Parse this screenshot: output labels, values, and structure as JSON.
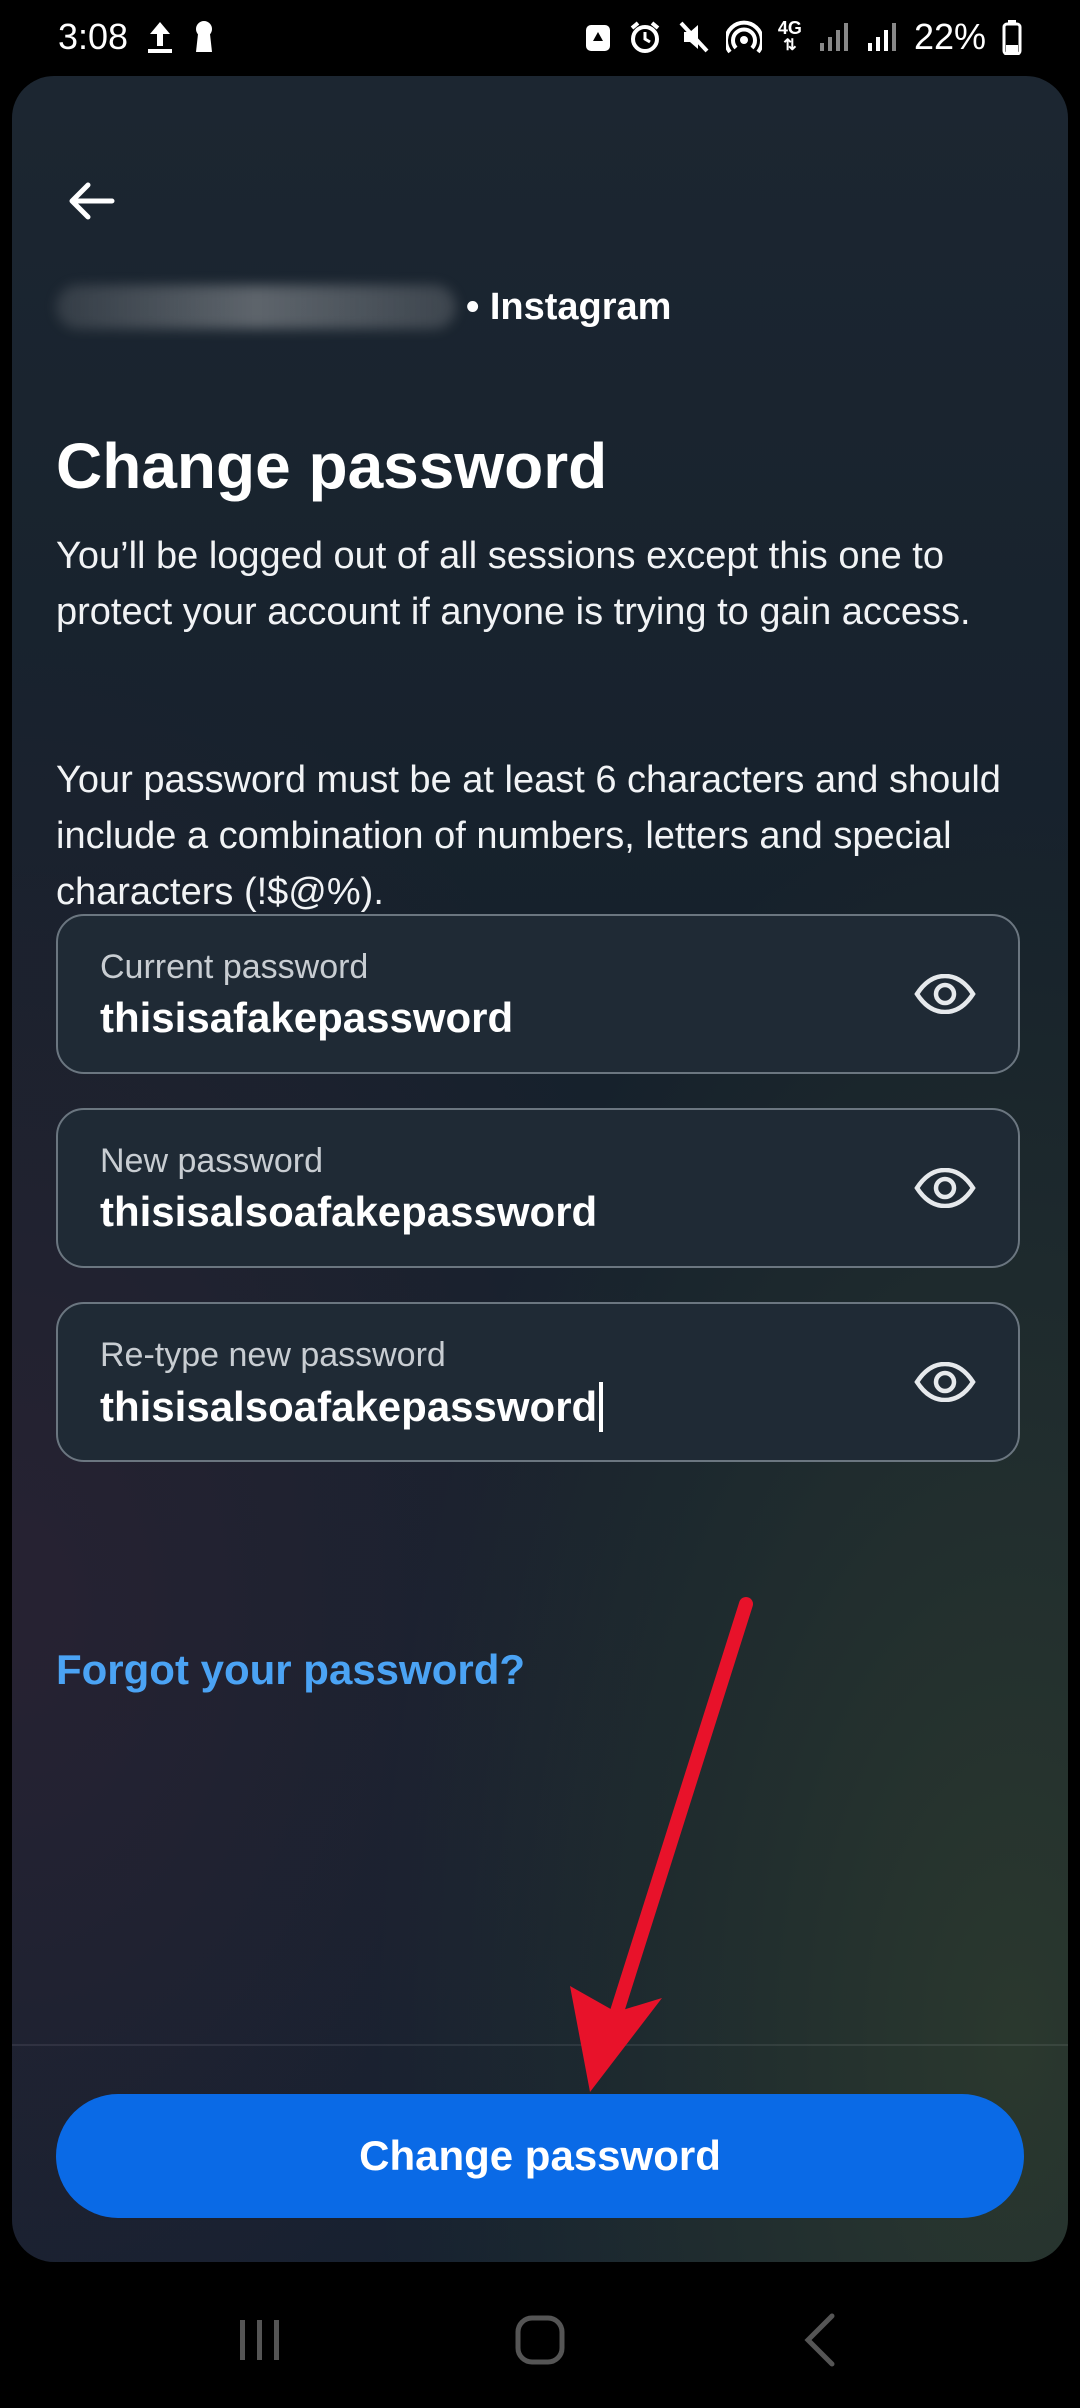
{
  "status_bar": {
    "time": "3:08",
    "network": "4G",
    "battery": "22%",
    "icons": [
      "upload-icon",
      "keyhole-icon",
      "recycle-icon",
      "alarm-icon",
      "mute-icon",
      "hotspot-icon",
      "signal-icon",
      "battery-icon"
    ]
  },
  "header": {
    "account_suffix": "• Instagram",
    "title": "Change password"
  },
  "description": {
    "p1": "You’ll be logged out of all sessions except this one to protect your account if anyone is trying to gain access.",
    "p2": "Your password must be at least 6 characters and should include a combination of numbers, letters and special characters (!$@%)."
  },
  "fields": [
    {
      "label": "Current password",
      "value": "thisisafakepassword"
    },
    {
      "label": "New password",
      "value": "thisisalsoafakepassword"
    },
    {
      "label": "Re-type new password",
      "value": "thisisalsoafakepassword"
    }
  ],
  "forgot_link": "Forgot your password?",
  "primary_button": "Change password",
  "colors": {
    "accent": "#0a6ae6",
    "link": "#4ba3f4",
    "annotation_arrow": "#e8122a"
  }
}
